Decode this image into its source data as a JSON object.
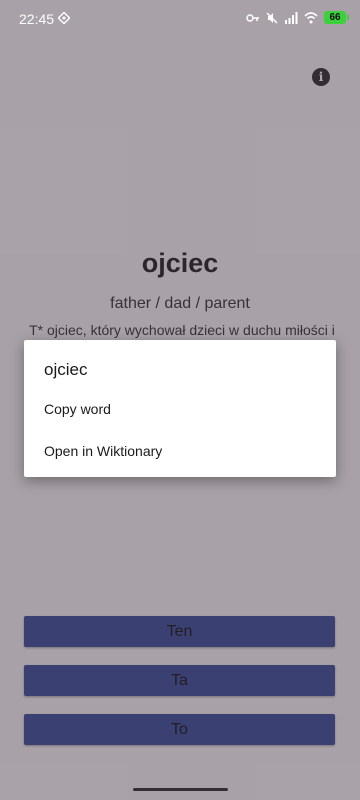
{
  "status_bar": {
    "time": "22:45",
    "battery": "66"
  },
  "card": {
    "word": "ojciec",
    "translation": "father / dad / parent",
    "example": "T* ojciec, który wychował dzieci w duchu miłości i"
  },
  "answers": [
    "Ten",
    "Ta",
    "To"
  ],
  "menu": {
    "title": "ojciec",
    "items": [
      "Copy word",
      "Open in Wiktionary"
    ]
  },
  "colors": {
    "answer_button": "#3b4a9c",
    "scrim": "rgba(60,50,60,0.42)",
    "battery": "#3cd13c"
  }
}
